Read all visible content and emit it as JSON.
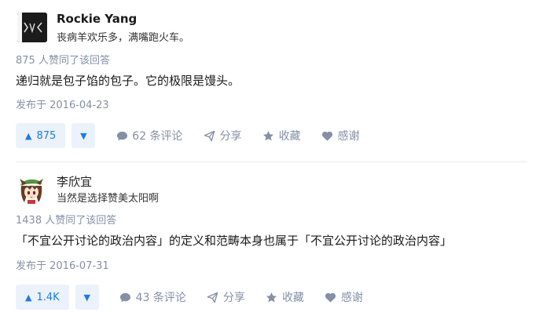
{
  "answers": [
    {
      "author_name": "Rockie Yang",
      "author_bio": "丧病羊欢乐多，满嘴跑火车。",
      "vote_summary": "875 人赞同了该回答",
      "content": "递归就是包子馅的包子。它的极限是馒头。",
      "published": "发布于 2016-04-23",
      "upvote_label": "875",
      "comments_label": "62 条评论",
      "share_label": "分享",
      "collect_label": "收藏",
      "thanks_label": "感谢"
    },
    {
      "author_name": "李欣宜",
      "author_bio": "当然是选择赞美太阳啊",
      "vote_summary": "1438 人赞同了该回答",
      "content": "「不宜公开讨论的政治内容」的定义和范畴本身也属于「不宜公开讨论的政治内容」",
      "published": "发布于 2016-07-31",
      "upvote_label": "1.4K",
      "comments_label": "43 条评论",
      "share_label": "分享",
      "collect_label": "收藏",
      "thanks_label": "感谢"
    }
  ],
  "colors": {
    "accent": "#1e7be0",
    "button_bg": "#ebf2fb",
    "muted": "#8590a6"
  },
  "icons": {
    "upvote": "triangle-up-icon",
    "downvote": "triangle-down-icon",
    "comment": "comment-bubble-icon",
    "share": "paper-plane-icon",
    "collect": "star-icon",
    "thanks": "heart-icon"
  }
}
